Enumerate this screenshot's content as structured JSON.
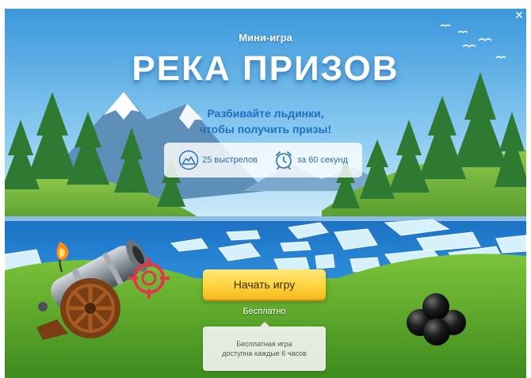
{
  "game": {
    "subtitle": "Мини-игра",
    "title": "РЕКА ПРИЗОВ",
    "tagline_line1": "Разбивайте льдинки,",
    "tagline_line2": "чтобы получить призы!",
    "shots_label": "25 выстрелов",
    "time_label": "за 60 секунд",
    "start_button": "Начать игру",
    "free_label": "Бесплатно",
    "tooltip_line1": "Бесплатная игра",
    "tooltip_line2": "доступна каждые 6 часов",
    "close_symbol": "✕"
  },
  "icons": [
    "close-icon",
    "mountain-icon",
    "alarm-clock-icon",
    "crosshair-icon",
    "cannon-icon",
    "cannonballs-icon"
  ],
  "colors": {
    "sky": "#4fa9e3",
    "title_shadow": "#3f8fd1",
    "tagline": "#1d6fc2",
    "button": "#ffd33d",
    "grass": "#5aa12c",
    "water": "#1f7fd0",
    "crosshair": "#e2384a"
  }
}
